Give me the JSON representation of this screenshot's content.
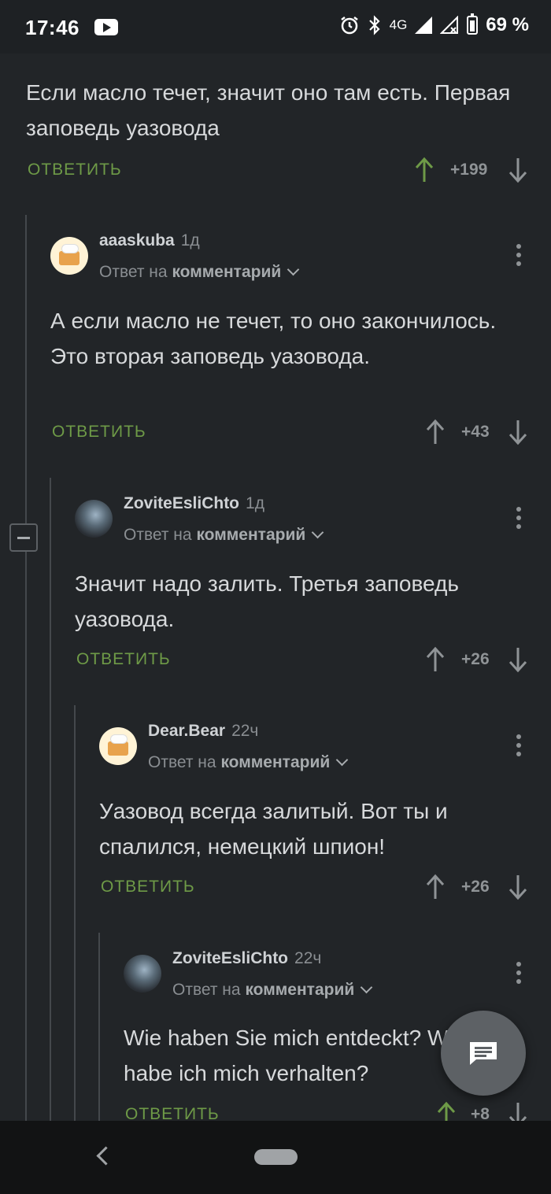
{
  "status_bar": {
    "time": "17:46",
    "network": "4G",
    "battery": "69 %",
    "icons": [
      "youtube-icon",
      "alarm-icon",
      "bluetooth-icon",
      "signal-icon",
      "no-wifi-icon",
      "battery-icon"
    ]
  },
  "top_comment": {
    "text": "Если масло течет, значит оно там есть. Первая заповедь уазовода",
    "reply_label": "ОТВЕТИТЬ",
    "score": "+199"
  },
  "comments": [
    {
      "author": "aaaskuba",
      "time": "1д",
      "reply_to_prefix": "Ответ на",
      "reply_to_link": "комментарий",
      "text": "А если масло не течет, то оно закончилось. Это вторая заповедь уазовода.",
      "reply_label": "ОТВЕТИТЬ",
      "score": "+43"
    },
    {
      "author": "ZoviteEsliChto",
      "time": "1д",
      "reply_to_prefix": "Ответ на",
      "reply_to_link": "комментарий",
      "text": "Значит надо залить. Третья заповедь уазовода.",
      "reply_label": "ОТВЕТИТЬ",
      "score": "+26"
    },
    {
      "author": "Dear.Bear",
      "time": "22ч",
      "reply_to_prefix": "Ответ на",
      "reply_to_link": "комментарий",
      "text": "Уазовод всегда залитый. Вот ты и спалился, немецкий шпион!",
      "reply_label": "ОТВЕТИТЬ",
      "score": "+26"
    },
    {
      "author": "ZoviteEsliChto",
      "time": "22ч",
      "reply_to_prefix": "Ответ на",
      "reply_to_link": "комментарий",
      "text": "Wie haben Sie mich entdeckt? Wie habe ich mich verhalten?",
      "reply_label": "ОТВЕТИТЬ",
      "score": "+8"
    }
  ],
  "colors": {
    "background": "#222528",
    "reply_green": "#6e9a47",
    "upvote_green": "#6e9a47",
    "muted": "#8f9396"
  }
}
